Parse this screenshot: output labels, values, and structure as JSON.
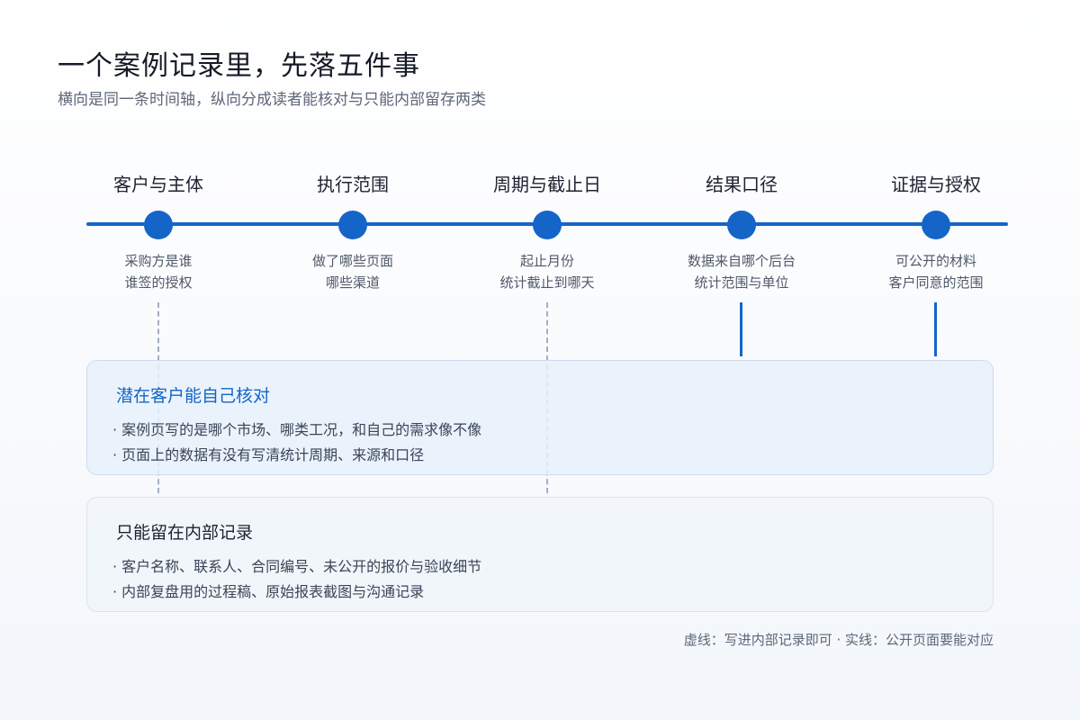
{
  "header": {
    "title": "一个案例记录里，先落五件事",
    "subtitle": "横向是同一条时间轴，纵向分成读者能核对与只能内部留存两类"
  },
  "stages": [
    {
      "label": "客户与主体",
      "note_line1": "采购方是谁",
      "note_line2": "谁签的授权"
    },
    {
      "label": "执行范围",
      "note_line1": "做了哪些页面",
      "note_line2": "哪些渠道"
    },
    {
      "label": "周期与截止日",
      "note_line1": "起止月份",
      "note_line2": "统计截止到哪天"
    },
    {
      "label": "结果口径",
      "note_line1": "数据来自哪个后台",
      "note_line2": "统计范围与单位"
    },
    {
      "label": "证据与授权",
      "note_line1": "可公开的材料",
      "note_line2": "客户同意的范围"
    }
  ],
  "public_box": {
    "title": "潜在客户能自己核对",
    "items": [
      "· 案例页写的是哪个市场、哪类工况，和自己的需求像不像",
      "· 页面上的数据有没有写清统计周期、来源和口径"
    ]
  },
  "internal_box": {
    "title": "只能留在内部记录",
    "items": [
      "· 客户名称、联系人、合同编号、未公开的报价与验收细节",
      "· 内部复盘用的过程稿、原始报表截图与沟通记录"
    ]
  },
  "legend": {
    "note": "虚线：写进内部记录即可 · 实线：公开页面要能对应"
  },
  "colors": {
    "accent": "#1565c8",
    "dashed": "#a3aec2"
  }
}
